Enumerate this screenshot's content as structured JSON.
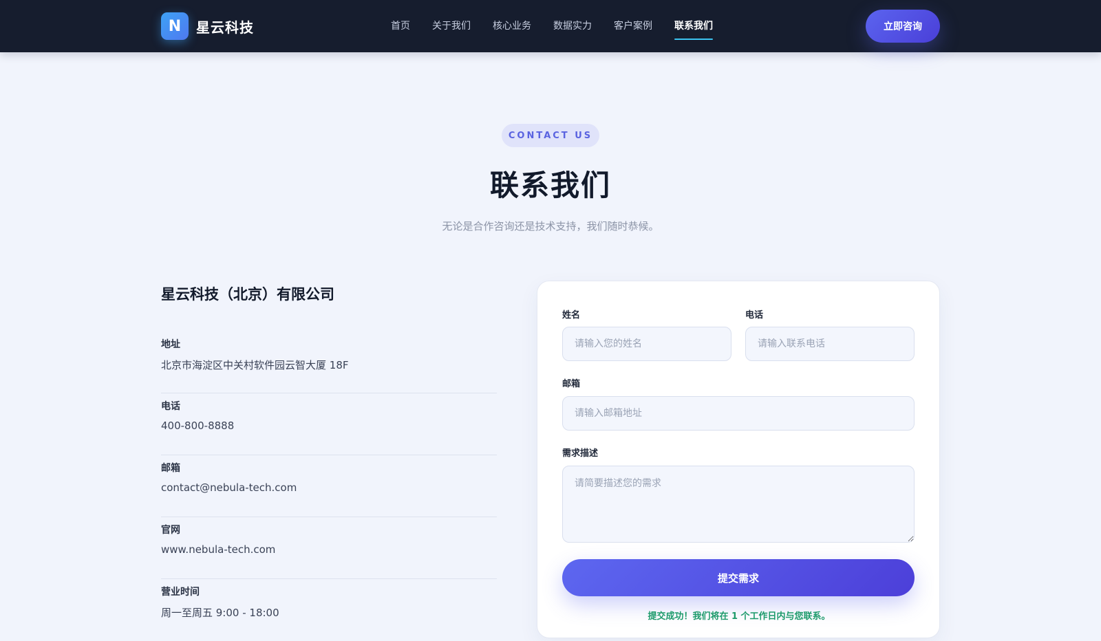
{
  "nav": {
    "logo_letter": "N",
    "brand": "星云科技",
    "links": [
      {
        "label": "首页"
      },
      {
        "label": "关于我们"
      },
      {
        "label": "核心业务"
      },
      {
        "label": "数据实力"
      },
      {
        "label": "客户案例"
      },
      {
        "label": "联系我们"
      }
    ],
    "active_index": 5,
    "cta": "立即咨询"
  },
  "hero": {
    "badge": "CONTACT US",
    "title": "联系我们",
    "subtitle": "无论是合作咨询还是技术支持，我们随时恭候。"
  },
  "info": {
    "company": "星云科技（北京）有限公司",
    "items": [
      {
        "label": "地址",
        "value": "北京市海淀区中关村软件园云智大厦 18F"
      },
      {
        "label": "电话",
        "value": "400-800-8888"
      },
      {
        "label": "邮箱",
        "value": "contact@nebula-tech.com"
      },
      {
        "label": "官网",
        "value": "www.nebula-tech.com"
      },
      {
        "label": "营业时间",
        "value": "周一至周五 9:00 - 18:00"
      }
    ]
  },
  "form": {
    "name_label": "姓名",
    "name_placeholder": "请输入您的姓名",
    "phone_label": "电话",
    "phone_placeholder": "请输入联系电话",
    "email_label": "邮箱",
    "email_placeholder": "请输入邮箱地址",
    "desc_label": "需求描述",
    "desc_placeholder": "请简要描述您的需求",
    "submit": "提交需求",
    "success": "提交成功！我们将在 1 个工作日内与您联系。"
  },
  "colors": {
    "nav_bg": "#161d2e",
    "accent": "#5b64ef",
    "active_underline": "#3cc4f0",
    "success": "#1c9a6a",
    "page_bg": "#f1f4fc"
  }
}
